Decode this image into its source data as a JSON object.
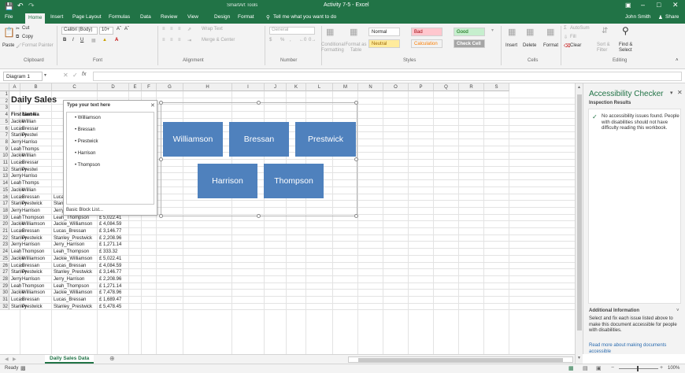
{
  "titlebar": {
    "save_icon": "save-icon",
    "undo_icon": "undo-icon",
    "redo_icon": "redo-icon",
    "contextual_title": "SmartArt Tools",
    "window_title": "Activity 7-5 - Excel",
    "controls": [
      "ribbon-display-icon",
      "minimize-icon",
      "maximize-icon",
      "close-icon"
    ]
  },
  "tabs": [
    "File",
    "Home",
    "Insert",
    "Page Layout",
    "Formulas",
    "Data",
    "Review",
    "View",
    "Design",
    "Format"
  ],
  "active_tab": "Home",
  "tell_me": "Tell me what you want to do",
  "user": "John Smith",
  "share": "Share",
  "ribbon": {
    "clipboard": {
      "paste": "Paste",
      "cut": "Cut",
      "copy": "Copy",
      "format_painter": "Format Painter",
      "label": "Clipboard"
    },
    "font": {
      "name": "Calibri (Body)",
      "size": "10+",
      "label": "Font",
      "bold": "B",
      "italic": "I",
      "underline": "U"
    },
    "alignment": {
      "wrap": "Wrap Text",
      "merge": "Merge & Center",
      "label": "Alignment"
    },
    "number": {
      "format": "General",
      "label": "Number",
      "currency": "$",
      "percent": "%",
      "comma": ","
    },
    "styles": {
      "conditional": "Conditional Formatting",
      "format_as": "Format as Table",
      "label": "Styles",
      "cells": [
        "Normal",
        "Bad",
        "Good",
        "Neutral",
        "Calculation",
        "Check Cell"
      ]
    },
    "cells": {
      "insert": "Insert",
      "delete": "Delete",
      "format": "Format",
      "label": "Cells"
    },
    "editing": {
      "autosum": "AutoSum",
      "fill": "Fill",
      "clear": "Clear",
      "sort": "Sort & Filter",
      "find": "Find & Select",
      "label": "Editing"
    }
  },
  "formula_bar": {
    "name_box": "Diagram 1",
    "fx": "fx",
    "value": ""
  },
  "columns": [
    "A",
    "B",
    "C",
    "D",
    "E",
    "F",
    "G",
    "H",
    "I",
    "J",
    "K",
    "L",
    "M",
    "N",
    "O",
    "P",
    "Q",
    "R",
    "S"
  ],
  "sheet_title": "Daily Sales",
  "headers": [
    "First Name",
    "Last Na"
  ],
  "hidden_rows": [
    [
      "Jackie",
      "Willian"
    ],
    [
      "Lucas",
      "Bressar"
    ],
    [
      "Stanley",
      "Prestwi"
    ],
    [
      "Jerry",
      "Harriso"
    ],
    [
      "Leah",
      "Thomps"
    ],
    [
      "Jackie",
      "Willian"
    ],
    [
      "Lucas",
      "Bressar"
    ],
    [
      "Stanley",
      "Prestwi"
    ],
    [
      "Jerry",
      "Harriso"
    ],
    [
      "Leah",
      "Thomps"
    ],
    [
      "Jackie",
      "Willian"
    ]
  ],
  "rows": [
    {
      "n": "16",
      "a": "Lucas",
      "b": "Bressan",
      "c": "Lucas_Bressan",
      "d": "£ 7,835.87"
    },
    {
      "n": "17",
      "a": "Stanley",
      "b": "Prestwick",
      "c": "Stanley_Prestwick",
      "d": "£ 6,898.05"
    },
    {
      "n": "18",
      "a": "Jerry",
      "b": "Harrison",
      "c": "Jerry_Harrison",
      "d": "£ 5,960.23"
    },
    {
      "n": "19",
      "a": "Leah",
      "b": "Thompson",
      "c": "Leah_Thompson",
      "d": "£ 5,022.41"
    },
    {
      "n": "20",
      "a": "Jackie",
      "b": "Williamson",
      "c": "Jackie_Williamson",
      "d": "£ 4,084.59"
    },
    {
      "n": "21",
      "a": "Lucas",
      "b": "Bressan",
      "c": "Lucas_Bressan",
      "d": "£ 3,146.77"
    },
    {
      "n": "22",
      "a": "Stanley",
      "b": "Prestwick",
      "c": "Stanley_Prestwick",
      "d": "£ 2,208.96"
    },
    {
      "n": "23",
      "a": "Jerry",
      "b": "Harrison",
      "c": "Jerry_Harrison",
      "d": "£ 1,271.14"
    },
    {
      "n": "24",
      "a": "Leah",
      "b": "Thompson",
      "c": "Leah_Thompson",
      "d": "£    333.32"
    },
    {
      "n": "25",
      "a": "Jackie",
      "b": "Williamson",
      "c": "Jackie_Williamson",
      "d": "£ 5,022.41"
    },
    {
      "n": "26",
      "a": "Lucas",
      "b": "Bressan",
      "c": "Lucas_Bressan",
      "d": "£ 4,084.59"
    },
    {
      "n": "27",
      "a": "Stanley",
      "b": "Prestwick",
      "c": "Stanley_Prestwick",
      "d": "£ 3,146.77"
    },
    {
      "n": "28",
      "a": "Jerry",
      "b": "Harrison",
      "c": "Jerry_Harrison",
      "d": "£ 2,208.96"
    },
    {
      "n": "29",
      "a": "Leah",
      "b": "Thompson",
      "c": "Leah_Thompson",
      "d": "£ 1,271.14"
    },
    {
      "n": "30",
      "a": "Jackie",
      "b": "Williamson",
      "c": "Jackie_Williamson",
      "d": "£ 7,478.96"
    },
    {
      "n": "31",
      "a": "Lucas",
      "b": "Bressan",
      "c": "Lucas_Bressan",
      "d": "£ 1,689.47"
    },
    {
      "n": "32",
      "a": "Stanley",
      "b": "Prestwick",
      "c": "Stanley_Prestwick",
      "d": "£ 5,478.45"
    }
  ],
  "text_pane": {
    "title": "Type your text here",
    "items": [
      "Williamson",
      "Bressan",
      "Prestwick",
      "Harrison",
      "Thompson"
    ],
    "footer": "Basic Block List..."
  },
  "smartart": {
    "boxes": [
      "Williamson",
      "Bressan",
      "Prestwick",
      "Harrison",
      "Thompson"
    ],
    "color": "#4f81bd"
  },
  "accessibility": {
    "title": "Accessibility Checker",
    "inspection": "Inspection Results",
    "message": "No accessibility issues found. People with disabilities should not have difficulty reading this workbook.",
    "additional": "Additional Information",
    "info": "Select and fix each issue listed above to make this document accessible for people with disabilities.",
    "link": "Read more about making documents accessible"
  },
  "sheet_tab": "Daily Sales Data",
  "status": {
    "ready": "Ready",
    "zoom": "100%"
  }
}
